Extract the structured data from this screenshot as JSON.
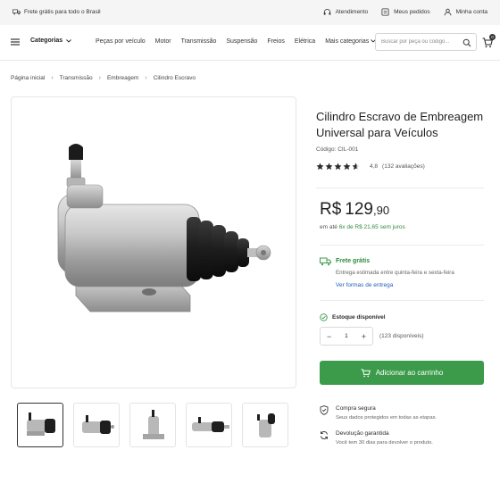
{
  "topbar": {
    "free_shipping": "Frete grátis para todo o Brasil",
    "service": "Atendimento",
    "orders": "Meus pedidos",
    "account": "Minha conta"
  },
  "nav": {
    "categories": "Categorias",
    "items": [
      "Peças por veículo",
      "Motor",
      "Transmissão",
      "Suspensão",
      "Freios",
      "Elétrica",
      "Mais categorias"
    ],
    "search_placeholder": "Buscar por peça ou código...",
    "cart_count": "0"
  },
  "breadcrumb": [
    "Página inicial",
    "Transmissão",
    "Embreagem",
    "Cilindro Escravo"
  ],
  "product": {
    "title": "Cilindro Escravo de Embreagem Universal para Veículos",
    "code": "Código: CIL-001",
    "rating_value": 4.8,
    "rating_text": "4,8",
    "reviews": "(132 avaliações)",
    "price_currency": "R$",
    "price_int": "129",
    "price_cents": ",90",
    "install_prefix": "em até ",
    "install_text": "6x de R$ 21,65 sem juros",
    "free_shipping": "Frete grátis",
    "eta": "Entrega estimada entre quinta-feira e sexta-feira",
    "delivery_link": "Ver formas de entrega",
    "stock": "Estoque disponível",
    "quantity": "1",
    "qty_minus": "−",
    "qty_plus": "+",
    "available": "(123 disponíveis)",
    "add_to_cart": "Adicionar ao carrinho"
  },
  "features": [
    {
      "title": "Compra segura",
      "sub": "Seus dados protegidos em todas as etapas."
    },
    {
      "title": "Devolução garantida",
      "sub": "Você tem 30 dias para devolver o produto."
    }
  ],
  "colors": {
    "accent_green": "#3b9b4a",
    "text_green": "#2e8b3e",
    "link_blue": "#1e5fb8"
  }
}
